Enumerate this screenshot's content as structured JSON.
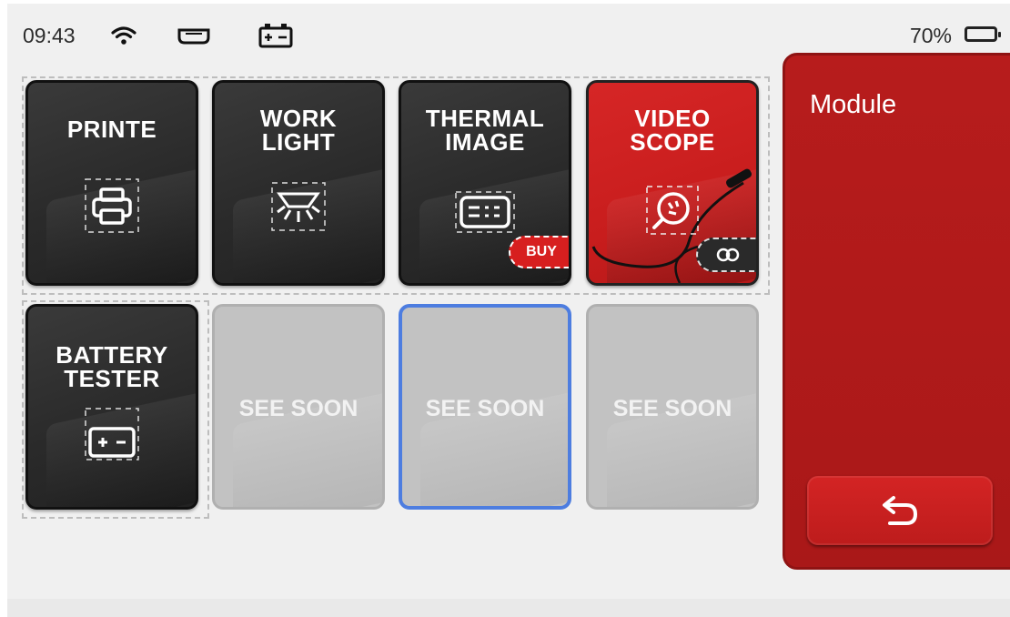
{
  "status_bar": {
    "time": "09:43",
    "battery_percent": "70%",
    "icons": [
      "wifi-icon",
      "vci-connector-icon",
      "battery-status-icon"
    ]
  },
  "tiles": [
    {
      "title": "PRINTE",
      "icon": "printer-icon",
      "style": "dark"
    },
    {
      "title": "WORK\nLIGHT",
      "icon": "work-light-icon",
      "style": "dark"
    },
    {
      "title": "THERMAL\nIMAGE",
      "icon": "thermal-image-icon",
      "style": "dark",
      "badge": "BUY"
    },
    {
      "title": "VIDEO\nSCOPE",
      "icon": "video-scope-icon",
      "style": "red",
      "badge_icon": "link-icon"
    },
    {
      "title": "BATTERY\nTESTER",
      "icon": "battery-tester-icon",
      "style": "dark"
    },
    {
      "title": "SEE SOON",
      "style": "grey"
    },
    {
      "title": "SEE SOON",
      "style": "grey",
      "selected": true
    },
    {
      "title": "SEE SOON",
      "style": "grey"
    }
  ],
  "panel": {
    "title": "Module",
    "back_icon": "back-arrow-icon"
  },
  "colors": {
    "accent_red": "#c81d1d",
    "panel_red": "#b01a1a",
    "selection_blue": "#4d7de0",
    "tile_dark": "#2f2f2f"
  }
}
